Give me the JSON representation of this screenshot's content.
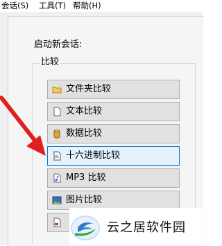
{
  "menubar": {
    "items": [
      {
        "label": "会话(S)"
      },
      {
        "label": "工具(T)"
      },
      {
        "label": "帮助(H)"
      }
    ]
  },
  "panel": {
    "section_title": "启动新会话:",
    "group_label": "比较",
    "buttons": [
      {
        "label": "文件夹比较",
        "icon": "folder-icon"
      },
      {
        "label": "文本比较",
        "icon": "text-document-icon"
      },
      {
        "label": "数据比较",
        "icon": "database-icon"
      },
      {
        "label": "十六进制比较",
        "icon": "hex-document-icon"
      },
      {
        "label": "MP3 比较",
        "icon": "music-file-icon"
      },
      {
        "label": "图片比较",
        "icon": "picture-icon"
      },
      {
        "label": "",
        "icon": "version-document-icon"
      }
    ]
  },
  "watermark": {
    "text": "云之居软件园"
  },
  "colors": {
    "arrow": "#e02020",
    "active_border": "#0078d7",
    "active_fill": "#e5f1fb"
  }
}
